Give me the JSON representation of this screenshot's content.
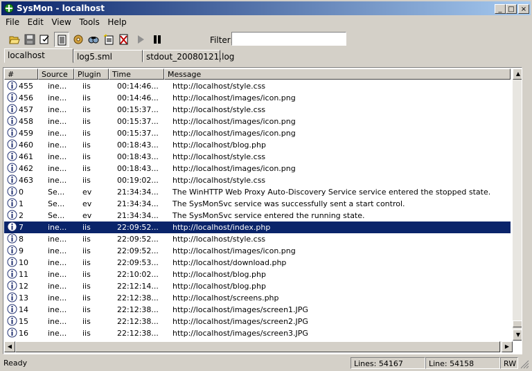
{
  "window": {
    "title": "SysMon - localhost"
  },
  "menu": [
    "File",
    "Edit",
    "View",
    "Tools",
    "Help"
  ],
  "toolbar": {
    "buttons": [
      "open-icon",
      "save-icon",
      "edit-icon",
      "log-icon",
      "settings-icon",
      "find-icon",
      "new-doc-icon",
      "clear-icon",
      "play-icon",
      "pause-icon"
    ],
    "filter_label": "Filter:",
    "filter_value": ""
  },
  "tabs": [
    "localhost",
    "log5.sml",
    "stdout_20080121.log"
  ],
  "columns": [
    "#",
    "Source",
    "Plugin",
    "Time",
    "Message"
  ],
  "rows": [
    {
      "id": "455",
      "source": "ine...",
      "plugin": "iis",
      "time": "00:14:46...",
      "message": "http://localhost/style.css"
    },
    {
      "id": "456",
      "source": "ine...",
      "plugin": "iis",
      "time": "00:14:46...",
      "message": "http://localhost/images/icon.png"
    },
    {
      "id": "457",
      "source": "ine...",
      "plugin": "iis",
      "time": "00:15:37...",
      "message": "http://localhost/style.css"
    },
    {
      "id": "458",
      "source": "ine...",
      "plugin": "iis",
      "time": "00:15:37...",
      "message": "http://localhost/images/icon.png"
    },
    {
      "id": "459",
      "source": "ine...",
      "plugin": "iis",
      "time": "00:15:37...",
      "message": "http://localhost/images/icon.png"
    },
    {
      "id": "460",
      "source": "ine...",
      "plugin": "iis",
      "time": "00:18:43...",
      "message": "http://localhost/blog.php"
    },
    {
      "id": "461",
      "source": "ine...",
      "plugin": "iis",
      "time": "00:18:43...",
      "message": "http://localhost/style.css"
    },
    {
      "id": "462",
      "source": "ine...",
      "plugin": "iis",
      "time": "00:18:43...",
      "message": "http://localhost/images/icon.png"
    },
    {
      "id": "463",
      "source": "ine...",
      "plugin": "iis",
      "time": "00:19:02...",
      "message": "http://localhost/style.css"
    },
    {
      "id": "0",
      "source": "Se...",
      "plugin": "ev",
      "time": "21:34:34...",
      "message": "The WinHTTP Web Proxy Auto-Discovery Service service entered the stopped state."
    },
    {
      "id": "1",
      "source": "Se...",
      "plugin": "ev",
      "time": "21:34:34...",
      "message": "The SysMonSvc service was successfully sent a start control."
    },
    {
      "id": "2",
      "source": "Se...",
      "plugin": "ev",
      "time": "21:34:34...",
      "message": "The SysMonSvc service entered the running state."
    },
    {
      "id": "7",
      "source": "ine...",
      "plugin": "iis",
      "time": "22:09:52...",
      "message": "http://localhost/index.php",
      "selected": true
    },
    {
      "id": "8",
      "source": "ine...",
      "plugin": "iis",
      "time": "22:09:52...",
      "message": "http://localhost/style.css"
    },
    {
      "id": "9",
      "source": "ine...",
      "plugin": "iis",
      "time": "22:09:52...",
      "message": "http://localhost/images/icon.png"
    },
    {
      "id": "10",
      "source": "ine...",
      "plugin": "iis",
      "time": "22:09:53...",
      "message": "http://localhost/download.php"
    },
    {
      "id": "11",
      "source": "ine...",
      "plugin": "iis",
      "time": "22:10:02...",
      "message": "http://localhost/blog.php"
    },
    {
      "id": "12",
      "source": "ine...",
      "plugin": "iis",
      "time": "22:12:14...",
      "message": "http://localhost/blog.php"
    },
    {
      "id": "13",
      "source": "ine...",
      "plugin": "iis",
      "time": "22:12:38...",
      "message": "http://localhost/screens.php"
    },
    {
      "id": "14",
      "source": "ine...",
      "plugin": "iis",
      "time": "22:12:38...",
      "message": "http://localhost/images/screen1.JPG"
    },
    {
      "id": "15",
      "source": "ine...",
      "plugin": "iis",
      "time": "22:12:38...",
      "message": "http://localhost/images/screen2.JPG"
    },
    {
      "id": "16",
      "source": "ine...",
      "plugin": "iis",
      "time": "22:12:38...",
      "message": "http://localhost/images/screen3.JPG"
    }
  ],
  "status": {
    "state": "Ready",
    "lines": "Lines: 54167",
    "line": "Line: 54158",
    "mode": "RW"
  },
  "colors": {
    "titlebar": "#0a246a",
    "selection": "#0a246a",
    "face": "#d4d0c8"
  }
}
